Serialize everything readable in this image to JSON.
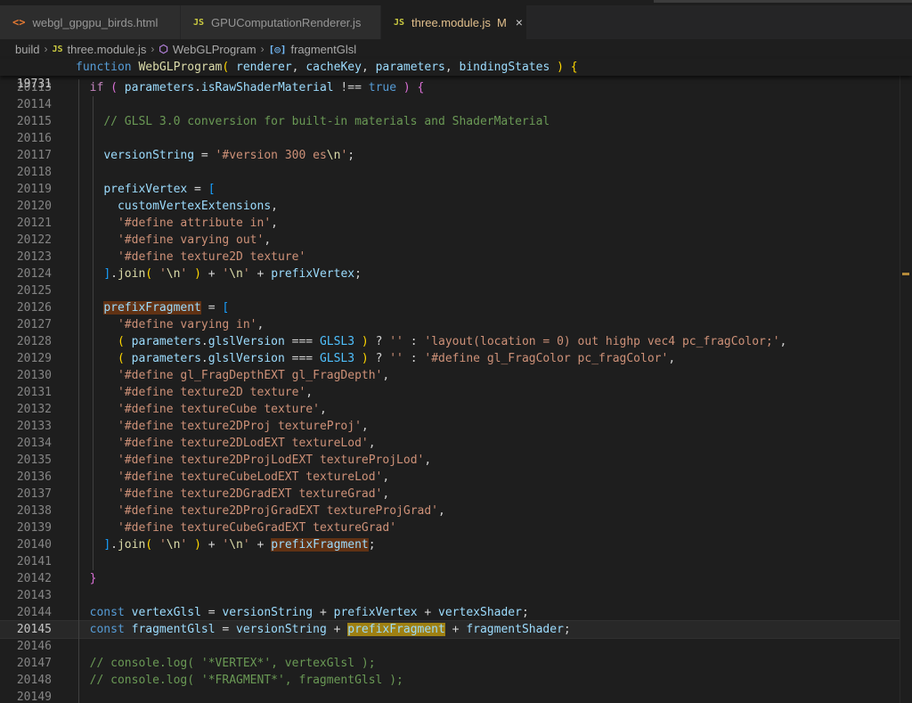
{
  "tabs": [
    {
      "icon": "<>",
      "label": "webgl_gpgpu_birds.html"
    },
    {
      "icon": "JS",
      "label": "GPUComputationRenderer.js"
    },
    {
      "icon": "JS",
      "label": "three.module.js",
      "modified": "M",
      "close": "×"
    }
  ],
  "breadcrumb": {
    "folder": "build",
    "file_icon": "JS",
    "file": "three.module.js",
    "class": "WebGLProgram",
    "symbol": "fragmentGlsl"
  },
  "sticky": {
    "line_number": "19731",
    "tokens": [
      {
        "t": "function",
        "c": "kw"
      },
      {
        "t": " ",
        "c": ""
      },
      {
        "t": "WebGLProgram",
        "c": "fn"
      },
      {
        "t": "(",
        "c": "br1"
      },
      {
        "t": " renderer",
        "c": "var"
      },
      {
        "t": ", ",
        "c": ""
      },
      {
        "t": "cacheKey",
        "c": "var"
      },
      {
        "t": ", ",
        "c": ""
      },
      {
        "t": "parameters",
        "c": "var"
      },
      {
        "t": ", ",
        "c": ""
      },
      {
        "t": "bindingStates",
        "c": "var"
      },
      {
        "t": " ",
        "c": ""
      },
      {
        "t": ")",
        "c": "br1"
      },
      {
        "t": " ",
        "c": ""
      },
      {
        "t": "{",
        "c": "br1"
      }
    ]
  },
  "lines": [
    {
      "n": "20113",
      "tokens": [
        {
          "t": "  ",
          "c": ""
        },
        {
          "t": "if",
          "c": "ctl"
        },
        {
          "t": " ",
          "c": ""
        },
        {
          "t": "(",
          "c": "br2"
        },
        {
          "t": " parameters",
          "c": "var"
        },
        {
          "t": ".",
          "c": ""
        },
        {
          "t": "isRawShaderMaterial",
          "c": "var"
        },
        {
          "t": " !== ",
          "c": ""
        },
        {
          "t": "true",
          "c": "kw"
        },
        {
          "t": " ",
          "c": ""
        },
        {
          "t": ")",
          "c": "br2"
        },
        {
          "t": " ",
          "c": ""
        },
        {
          "t": "{",
          "c": "br2"
        }
      ]
    },
    {
      "n": "20114",
      "tokens": []
    },
    {
      "n": "20115",
      "tokens": [
        {
          "t": "    ",
          "c": ""
        },
        {
          "t": "// GLSL 3.0 conversion for built-in materials and ShaderMaterial",
          "c": "cmt"
        }
      ]
    },
    {
      "n": "20116",
      "tokens": []
    },
    {
      "n": "20117",
      "tokens": [
        {
          "t": "    ",
          "c": ""
        },
        {
          "t": "versionString",
          "c": "var"
        },
        {
          "t": " = ",
          "c": ""
        },
        {
          "t": "'#version 300 es",
          "c": "str"
        },
        {
          "t": "\\n",
          "c": "fn"
        },
        {
          "t": "'",
          "c": "str"
        },
        {
          "t": ";",
          "c": ""
        }
      ]
    },
    {
      "n": "20118",
      "tokens": []
    },
    {
      "n": "20119",
      "tokens": [
        {
          "t": "    ",
          "c": ""
        },
        {
          "t": "prefixVertex",
          "c": "var"
        },
        {
          "t": " = ",
          "c": ""
        },
        {
          "t": "[",
          "c": "br3"
        }
      ]
    },
    {
      "n": "20120",
      "tokens": [
        {
          "t": "      ",
          "c": ""
        },
        {
          "t": "customVertexExtensions",
          "c": "var"
        },
        {
          "t": ",",
          "c": ""
        }
      ]
    },
    {
      "n": "20121",
      "tokens": [
        {
          "t": "      ",
          "c": ""
        },
        {
          "t": "'#define attribute in'",
          "c": "str"
        },
        {
          "t": ",",
          "c": ""
        }
      ]
    },
    {
      "n": "20122",
      "tokens": [
        {
          "t": "      ",
          "c": ""
        },
        {
          "t": "'#define varying out'",
          "c": "str"
        },
        {
          "t": ",",
          "c": ""
        }
      ]
    },
    {
      "n": "20123",
      "tokens": [
        {
          "t": "      ",
          "c": ""
        },
        {
          "t": "'#define texture2D texture'",
          "c": "str"
        }
      ]
    },
    {
      "n": "20124",
      "tokens": [
        {
          "t": "    ",
          "c": ""
        },
        {
          "t": "]",
          "c": "br3"
        },
        {
          "t": ".",
          "c": ""
        },
        {
          "t": "join",
          "c": "fn"
        },
        {
          "t": "(",
          "c": "br1"
        },
        {
          "t": " ",
          "c": ""
        },
        {
          "t": "'",
          "c": "str"
        },
        {
          "t": "\\n",
          "c": "fn"
        },
        {
          "t": "'",
          "c": "str"
        },
        {
          "t": " ",
          "c": ""
        },
        {
          "t": ")",
          "c": "br1"
        },
        {
          "t": " + ",
          "c": ""
        },
        {
          "t": "'",
          "c": "str"
        },
        {
          "t": "\\n",
          "c": "fn"
        },
        {
          "t": "'",
          "c": "str"
        },
        {
          "t": " + ",
          "c": ""
        },
        {
          "t": "prefixVertex",
          "c": "var"
        },
        {
          "t": ";",
          "c": ""
        }
      ]
    },
    {
      "n": "20125",
      "tokens": []
    },
    {
      "n": "20126",
      "tokens": [
        {
          "t": "    ",
          "c": ""
        },
        {
          "t": "prefixFragment",
          "c": "var hl"
        },
        {
          "t": " = ",
          "c": ""
        },
        {
          "t": "[",
          "c": "br3"
        }
      ]
    },
    {
      "n": "20127",
      "tokens": [
        {
          "t": "      ",
          "c": ""
        },
        {
          "t": "'#define varying in'",
          "c": "str"
        },
        {
          "t": ",",
          "c": ""
        }
      ]
    },
    {
      "n": "20128",
      "tokens": [
        {
          "t": "      ",
          "c": ""
        },
        {
          "t": "(",
          "c": "br1"
        },
        {
          "t": " parameters",
          "c": "var"
        },
        {
          "t": ".",
          "c": ""
        },
        {
          "t": "glslVersion",
          "c": "var"
        },
        {
          "t": " === ",
          "c": ""
        },
        {
          "t": "GLSL3",
          "c": "cst"
        },
        {
          "t": " ",
          "c": ""
        },
        {
          "t": ")",
          "c": "br1"
        },
        {
          "t": " ? ",
          "c": ""
        },
        {
          "t": "''",
          "c": "str"
        },
        {
          "t": " : ",
          "c": ""
        },
        {
          "t": "'layout(location = 0) out highp vec4 pc_fragColor;'",
          "c": "str"
        },
        {
          "t": ",",
          "c": ""
        }
      ]
    },
    {
      "n": "20129",
      "tokens": [
        {
          "t": "      ",
          "c": ""
        },
        {
          "t": "(",
          "c": "br1"
        },
        {
          "t": " parameters",
          "c": "var"
        },
        {
          "t": ".",
          "c": ""
        },
        {
          "t": "glslVersion",
          "c": "var"
        },
        {
          "t": " === ",
          "c": ""
        },
        {
          "t": "GLSL3",
          "c": "cst"
        },
        {
          "t": " ",
          "c": ""
        },
        {
          "t": ")",
          "c": "br1"
        },
        {
          "t": " ? ",
          "c": ""
        },
        {
          "t": "''",
          "c": "str"
        },
        {
          "t": " : ",
          "c": ""
        },
        {
          "t": "'#define gl_FragColor pc_fragColor'",
          "c": "str"
        },
        {
          "t": ",",
          "c": ""
        }
      ]
    },
    {
      "n": "20130",
      "tokens": [
        {
          "t": "      ",
          "c": ""
        },
        {
          "t": "'#define gl_FragDepthEXT gl_FragDepth'",
          "c": "str"
        },
        {
          "t": ",",
          "c": ""
        }
      ]
    },
    {
      "n": "20131",
      "tokens": [
        {
          "t": "      ",
          "c": ""
        },
        {
          "t": "'#define texture2D texture'",
          "c": "str"
        },
        {
          "t": ",",
          "c": ""
        }
      ]
    },
    {
      "n": "20132",
      "tokens": [
        {
          "t": "      ",
          "c": ""
        },
        {
          "t": "'#define textureCube texture'",
          "c": "str"
        },
        {
          "t": ",",
          "c": ""
        }
      ]
    },
    {
      "n": "20133",
      "tokens": [
        {
          "t": "      ",
          "c": ""
        },
        {
          "t": "'#define texture2DProj textureProj'",
          "c": "str"
        },
        {
          "t": ",",
          "c": ""
        }
      ]
    },
    {
      "n": "20134",
      "tokens": [
        {
          "t": "      ",
          "c": ""
        },
        {
          "t": "'#define texture2DLodEXT textureLod'",
          "c": "str"
        },
        {
          "t": ",",
          "c": ""
        }
      ]
    },
    {
      "n": "20135",
      "tokens": [
        {
          "t": "      ",
          "c": ""
        },
        {
          "t": "'#define texture2DProjLodEXT textureProjLod'",
          "c": "str"
        },
        {
          "t": ",",
          "c": ""
        }
      ]
    },
    {
      "n": "20136",
      "tokens": [
        {
          "t": "      ",
          "c": ""
        },
        {
          "t": "'#define textureCubeLodEXT textureLod'",
          "c": "str"
        },
        {
          "t": ",",
          "c": ""
        }
      ]
    },
    {
      "n": "20137",
      "tokens": [
        {
          "t": "      ",
          "c": ""
        },
        {
          "t": "'#define texture2DGradEXT textureGrad'",
          "c": "str"
        },
        {
          "t": ",",
          "c": ""
        }
      ]
    },
    {
      "n": "20138",
      "tokens": [
        {
          "t": "      ",
          "c": ""
        },
        {
          "t": "'#define texture2DProjGradEXT textureProjGrad'",
          "c": "str"
        },
        {
          "t": ",",
          "c": ""
        }
      ]
    },
    {
      "n": "20139",
      "tokens": [
        {
          "t": "      ",
          "c": ""
        },
        {
          "t": "'#define textureCubeGradEXT textureGrad'",
          "c": "str"
        }
      ]
    },
    {
      "n": "20140",
      "tokens": [
        {
          "t": "    ",
          "c": ""
        },
        {
          "t": "]",
          "c": "br3"
        },
        {
          "t": ".",
          "c": ""
        },
        {
          "t": "join",
          "c": "fn"
        },
        {
          "t": "(",
          "c": "br1"
        },
        {
          "t": " ",
          "c": ""
        },
        {
          "t": "'",
          "c": "str"
        },
        {
          "t": "\\n",
          "c": "fn"
        },
        {
          "t": "'",
          "c": "str"
        },
        {
          "t": " ",
          "c": ""
        },
        {
          "t": ")",
          "c": "br1"
        },
        {
          "t": " + ",
          "c": ""
        },
        {
          "t": "'",
          "c": "str"
        },
        {
          "t": "\\n",
          "c": "fn"
        },
        {
          "t": "'",
          "c": "str"
        },
        {
          "t": " + ",
          "c": ""
        },
        {
          "t": "prefixFragment",
          "c": "var hl"
        },
        {
          "t": ";",
          "c": ""
        }
      ]
    },
    {
      "n": "20141",
      "tokens": []
    },
    {
      "n": "20142",
      "tokens": [
        {
          "t": "  ",
          "c": ""
        },
        {
          "t": "}",
          "c": "br2"
        }
      ]
    },
    {
      "n": "20143",
      "tokens": []
    },
    {
      "n": "20144",
      "tokens": [
        {
          "t": "  ",
          "c": ""
        },
        {
          "t": "const",
          "c": "kw"
        },
        {
          "t": " ",
          "c": ""
        },
        {
          "t": "vertexGlsl",
          "c": "var"
        },
        {
          "t": " = ",
          "c": ""
        },
        {
          "t": "versionString",
          "c": "var"
        },
        {
          "t": " + ",
          "c": ""
        },
        {
          "t": "prefixVertex",
          "c": "var"
        },
        {
          "t": " + ",
          "c": ""
        },
        {
          "t": "vertexShader",
          "c": "var"
        },
        {
          "t": ";",
          "c": ""
        }
      ]
    },
    {
      "n": "20145",
      "current": true,
      "tokens": [
        {
          "t": "  ",
          "c": ""
        },
        {
          "t": "const",
          "c": "kw"
        },
        {
          "t": " ",
          "c": ""
        },
        {
          "t": "fragmentGlsl",
          "c": "var"
        },
        {
          "t": " = ",
          "c": ""
        },
        {
          "t": "versionString",
          "c": "var"
        },
        {
          "t": " + ",
          "c": ""
        },
        {
          "t": "prefixFragment",
          "c": "hlc"
        },
        {
          "t": " + ",
          "c": ""
        },
        {
          "t": "fragmentShader",
          "c": "var"
        },
        {
          "t": ";",
          "c": ""
        }
      ]
    },
    {
      "n": "20146",
      "tokens": []
    },
    {
      "n": "20147",
      "tokens": [
        {
          "t": "  ",
          "c": ""
        },
        {
          "t": "// console.log( '*VERTEX*', vertexGlsl );",
          "c": "cmt"
        }
      ]
    },
    {
      "n": "20148",
      "tokens": [
        {
          "t": "  ",
          "c": ""
        },
        {
          "t": "// console.log( '*FRAGMENT*', fragmentGlsl );",
          "c": "cmt"
        }
      ]
    },
    {
      "n": "20149",
      "tokens": []
    }
  ],
  "colors": {
    "editor_bg": "#1e1e1e",
    "tab_bar_bg": "#252526",
    "modified_tab_fg": "#e2c08d",
    "find_match": "#613214",
    "current_match": "#9e6a03"
  }
}
